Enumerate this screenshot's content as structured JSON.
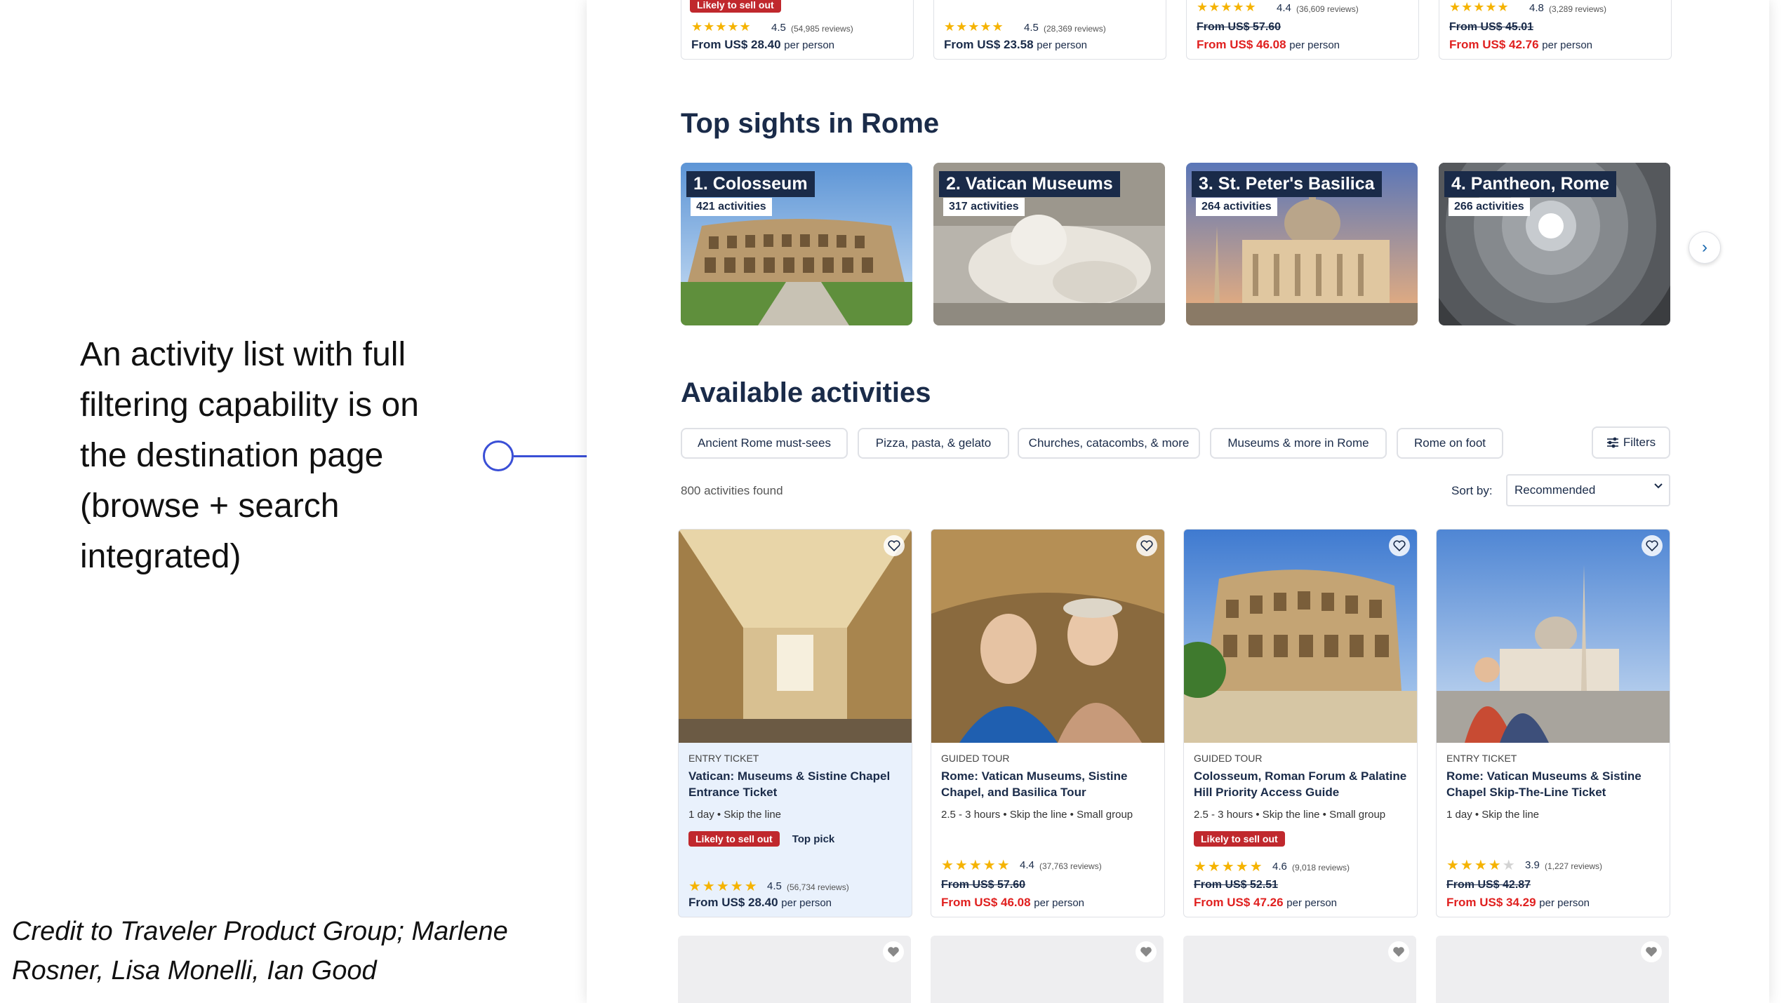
{
  "slide": {
    "description": "An activity list with full filtering capability is on the destination page (browse + search integrated)",
    "credit": "Credit to Traveler Product Group; Marlene Rosner, Lisa Monelli, Ian Good"
  },
  "top_row": [
    {
      "badge": "Likely to sell out",
      "rating": "4.5",
      "reviews": "(54,985 reviews)",
      "old_price": "",
      "price": "From US$ 28.40",
      "per": "per person"
    },
    {
      "badge": "",
      "rating": "4.5",
      "reviews": "(28,369 reviews)",
      "old_price": "",
      "price": "From US$ 23.58",
      "per": "per person"
    },
    {
      "badge": "",
      "rating": "4.4",
      "reviews": "(36,609 reviews)",
      "old_price": "From US$ 57.60",
      "price": "From US$ 46.08",
      "per": "per person"
    },
    {
      "badge": "",
      "rating": "4.8",
      "reviews": "(3,289 reviews)",
      "old_price": "From US$ 45.01",
      "price": "From US$ 42.76",
      "per": "per person"
    }
  ],
  "top_sights": {
    "heading": "Top sights in Rome",
    "items": [
      {
        "title": "1. Colosseum",
        "count": "421 activities"
      },
      {
        "title": "2. Vatican Museums",
        "count": "317 activities"
      },
      {
        "title": "3. St. Peter's Basilica",
        "count": "264 activities"
      },
      {
        "title": "4. Pantheon, Rome",
        "count": "266 activities"
      }
    ]
  },
  "activities": {
    "heading": "Available activities",
    "chips": [
      "Ancient Rome must-sees",
      "Pizza, pasta, & gelato",
      "Churches, catacombs, & more",
      "Museums & more in Rome",
      "Rome on foot"
    ],
    "filters_label": "Filters",
    "found": "800 activities found",
    "sort_label": "Sort by:",
    "sort_value": "Recommended",
    "cards": [
      {
        "category": "ENTRY TICKET",
        "title": "Vatican: Museums & Sistine Chapel Entrance Ticket",
        "meta": "1 day • Skip the line",
        "badge": "Likely to sell out",
        "top_pick": "Top pick",
        "rating": "4.5",
        "stars": 4.5,
        "reviews": "(56,734 reviews)",
        "old_price": "",
        "price": "From US$ 28.40",
        "per": "per person"
      },
      {
        "category": "GUIDED TOUR",
        "title": "Rome: Vatican Museums, Sistine Chapel, and Basilica Tour",
        "meta": "2.5 - 3 hours • Skip the line • Small group",
        "badge": "",
        "top_pick": "",
        "rating": "4.4",
        "stars": 4.5,
        "reviews": "(37,763 reviews)",
        "old_price": "From US$ 57.60",
        "price": "From US$ 46.08",
        "per": "per person"
      },
      {
        "category": "GUIDED TOUR",
        "title": "Colosseum, Roman Forum & Palatine Hill Priority Access Guide",
        "meta": "2.5 - 3 hours • Skip the line • Small group",
        "badge": "Likely to sell out",
        "top_pick": "",
        "rating": "4.6",
        "stars": 4.5,
        "reviews": "(9,018 reviews)",
        "old_price": "From US$ 52.51",
        "price": "From US$ 47.26",
        "per": "per person"
      },
      {
        "category": "ENTRY TICKET",
        "title": "Rome: Vatican Museums & Sistine Chapel Skip-The-Line Ticket",
        "meta": "1 day • Skip the line",
        "badge": "",
        "top_pick": "",
        "rating": "3.9",
        "stars": 4,
        "reviews": "(1,227 reviews)",
        "old_price": "From US$ 42.87",
        "price": "From US$ 34.29",
        "per": "per person"
      }
    ]
  },
  "colors": {
    "navy": "#1a2b49",
    "accent_red": "#c0282d",
    "price_red": "#e0201f",
    "star": "#f5b301",
    "callout_blue": "#3a4fd6"
  }
}
